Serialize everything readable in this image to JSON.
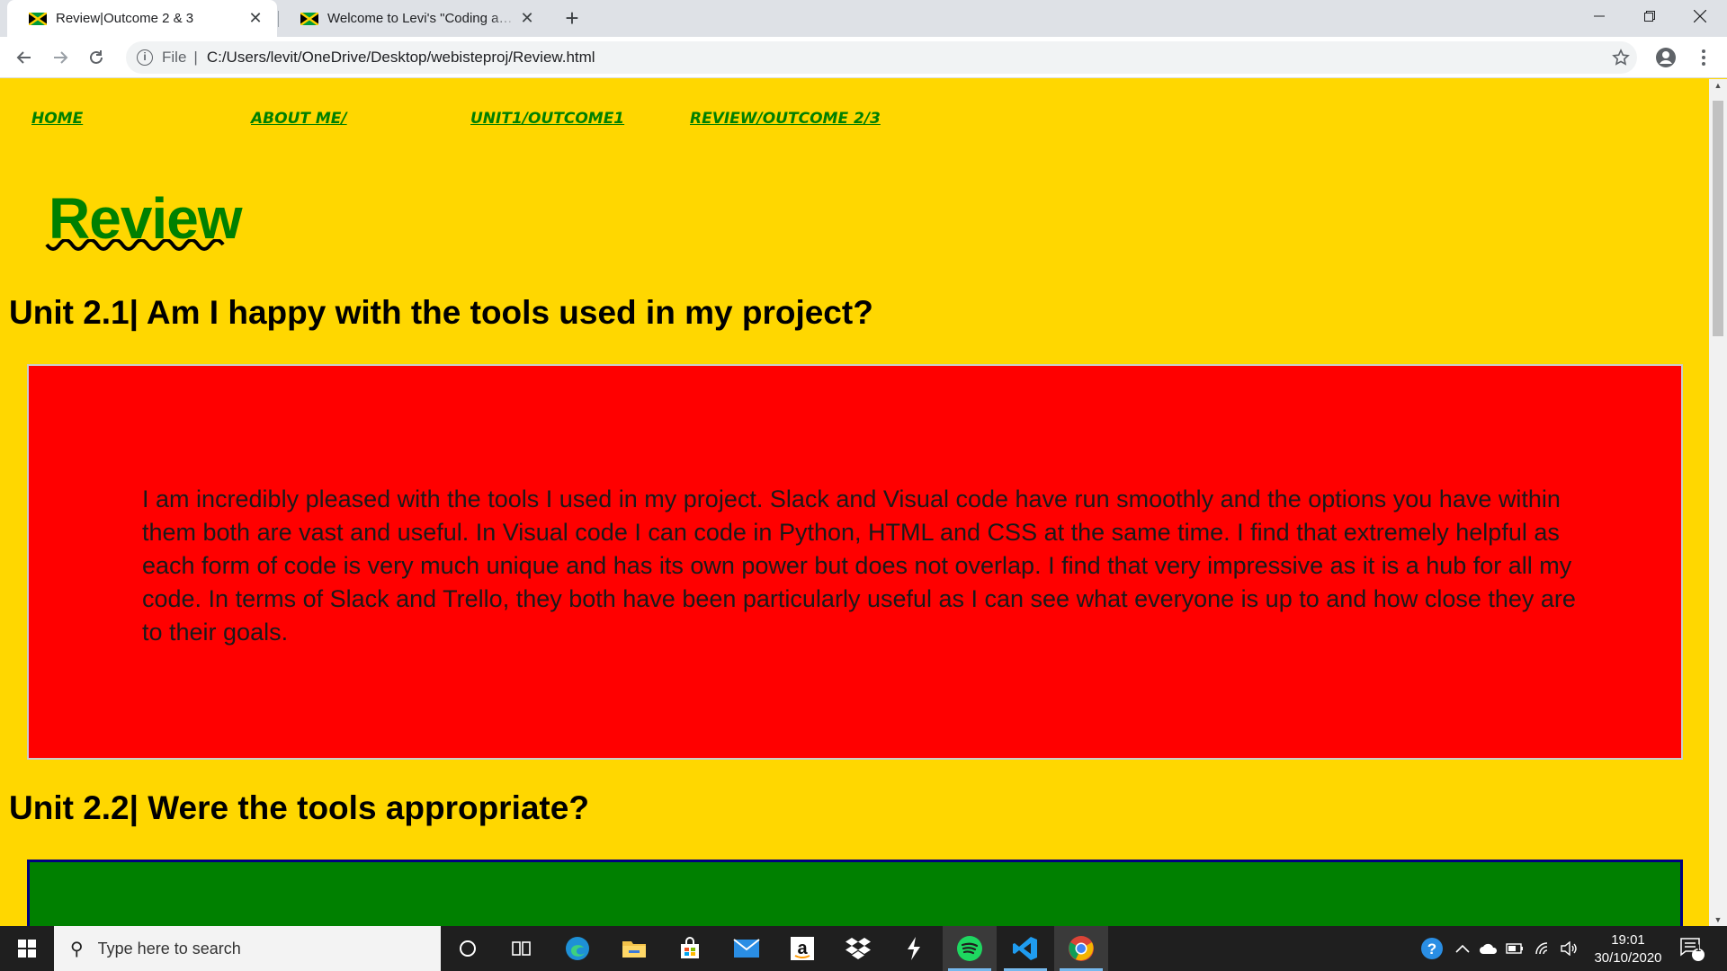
{
  "browser": {
    "tabs": [
      {
        "title": "Review|Outcome 2 & 3",
        "active": true
      },
      {
        "title": "Welcome to Levi's \"Coding and Computing\"",
        "active": false
      }
    ],
    "address": {
      "scheme": "File",
      "path": "C:/Users/levit/OneDrive/Desktop/webisteproj/Review.html"
    }
  },
  "page": {
    "nav": [
      "HOME",
      "ABOUT ME/",
      "UNIT1/OUTCOME1",
      "REVIEW/OUTCOME 2/3"
    ],
    "title": "Review",
    "sections": [
      {
        "heading": "Unit 2.1| Am I happy with the tools used in my project?",
        "body": "I am incredibly pleased with the tools I used in my project. Slack and Visual code have run smoothly and the options you have within them both are vast and useful. In Visual code I can code in Python, HTML and CSS at the same time. I find that extremely helpful as each form of code is very much unique and has its own power but does not overlap. I find that very impressive as it is a hub for all my code. In terms of Slack and Trello, they both have been particularly useful as I can see what everyone is up to and how close they are to their goals."
      },
      {
        "heading": "Unit 2.2| Were the tools appropriate?"
      }
    ]
  },
  "taskbar": {
    "search_placeholder": "Type here to search",
    "time": "19:01",
    "date": "30/10/2020",
    "notification_count": "1",
    "apps": [
      "cortana-icon",
      "task-view-icon",
      "edge-icon",
      "file-explorer-icon",
      "store-icon",
      "mail-icon",
      "amazon-icon",
      "dropbox-icon",
      "slack-icon",
      "spotify-icon",
      "vscode-icon",
      "chrome-icon"
    ]
  },
  "colors": {
    "page_bg": "#ffd700",
    "nav_link": "#008000",
    "box_red": "#ff0000",
    "box_green": "#008000"
  }
}
